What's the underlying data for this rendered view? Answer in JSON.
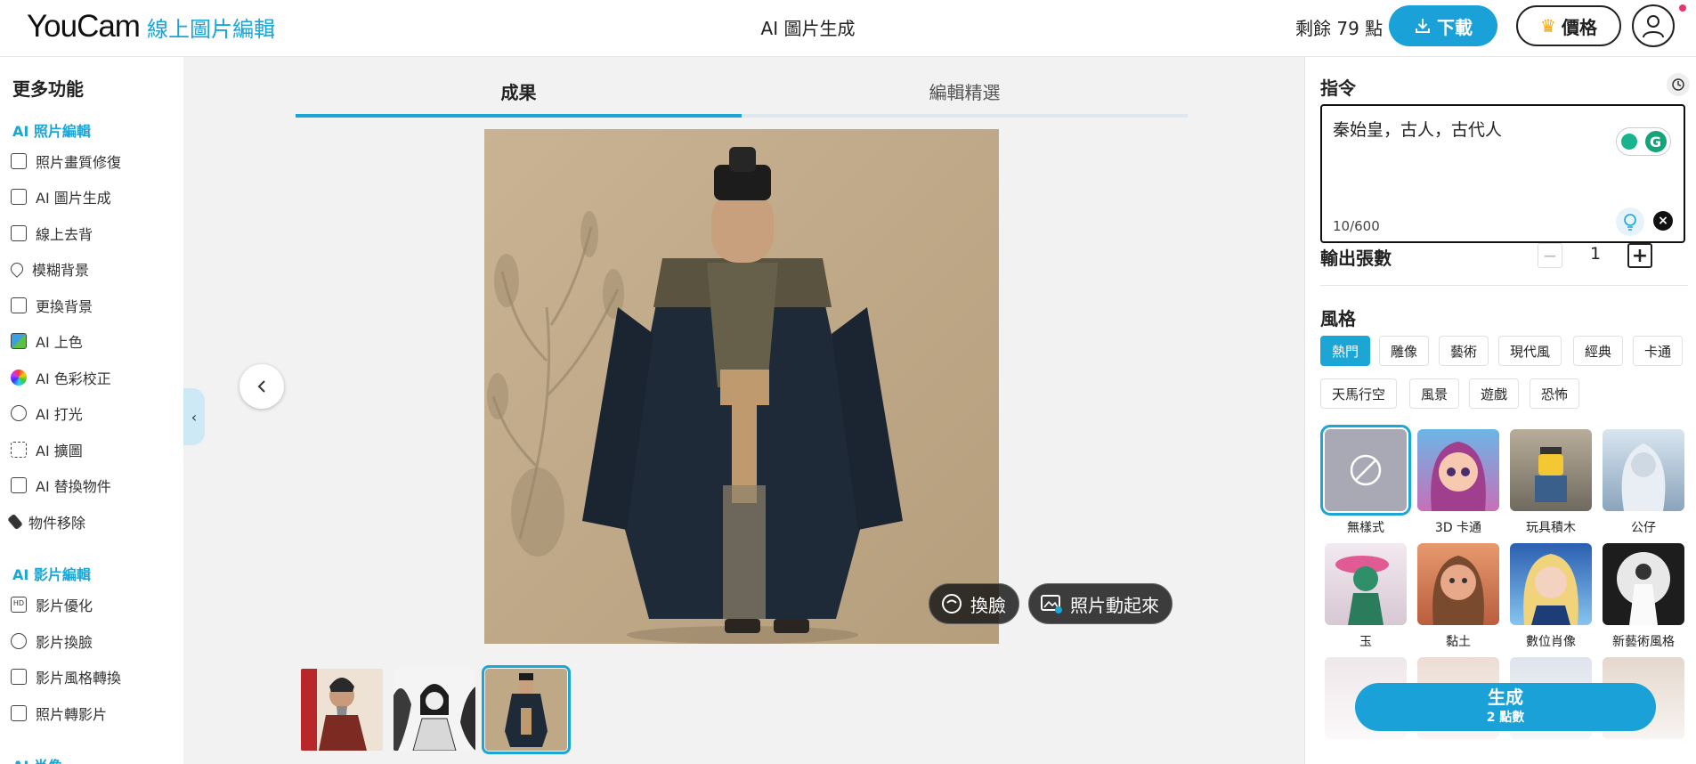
{
  "header": {
    "logo_main": "YouCam",
    "logo_sub": "線上圖片編輯",
    "page_title": "AI 圖片生成",
    "credits": "剩餘 79 點",
    "download_label": "下載",
    "price_label": "價格"
  },
  "sidebar": {
    "title": "更多功能",
    "section_photo": "AI 照片編輯",
    "photo_items": [
      {
        "label": "照片畫質修復",
        "icon": "image-enhance-icon"
      },
      {
        "label": "AI 圖片生成",
        "icon": "ai-image-icon"
      },
      {
        "label": "線上去背",
        "icon": "remove-bg-icon"
      },
      {
        "label": "模糊背景",
        "icon": "blur-drop-icon"
      },
      {
        "label": "更換背景",
        "icon": "change-bg-icon"
      },
      {
        "label": "AI 上色",
        "icon": "colorize-icon"
      },
      {
        "label": "AI 色彩校正",
        "icon": "color-wheel-icon"
      },
      {
        "label": "AI 打光",
        "icon": "light-icon"
      },
      {
        "label": "AI 擴圖",
        "icon": "expand-icon"
      },
      {
        "label": "AI 替換物件",
        "icon": "replace-icon"
      },
      {
        "label": "物件移除",
        "icon": "eraser-icon"
      }
    ],
    "section_video": "AI 影片編輯",
    "video_items": [
      {
        "label": "影片優化",
        "icon": "hd-icon"
      },
      {
        "label": "影片換臉",
        "icon": "face-swap-icon"
      },
      {
        "label": "影片風格轉換",
        "icon": "style-transfer-icon"
      },
      {
        "label": "照片轉影片",
        "icon": "photo-to-video-icon"
      }
    ],
    "section_portrait": "AI 肖像"
  },
  "main": {
    "tabs": [
      {
        "label": "成果",
        "active": true
      },
      {
        "label": "編輯精選",
        "active": false
      }
    ],
    "face_swap_label": "換臉",
    "animate_label": "照片動起來"
  },
  "panel": {
    "prompt_heading": "指令",
    "prompt_text": "秦始皇，古人，古代人",
    "prompt_count": "10/600",
    "output_count_label": "輸出張數",
    "output_count_value": "1",
    "style_heading": "風格",
    "style_chips": [
      "熱門",
      "雕像",
      "藝術",
      "現代風",
      "經典",
      "卡通",
      "天馬行空",
      "風景",
      "遊戲",
      "恐怖"
    ],
    "style_tiles": [
      "無樣式",
      "3D 卡通",
      "玩具積木",
      "公仔",
      "玉",
      "黏土",
      "數位肖像",
      "新藝術風格"
    ],
    "generate_label": "生成",
    "generate_cost": "2 點數"
  },
  "colors": {
    "accent": "#1ba6d6",
    "button_blue": "#1aa2d8",
    "main_bg": "#f2f2f2"
  }
}
